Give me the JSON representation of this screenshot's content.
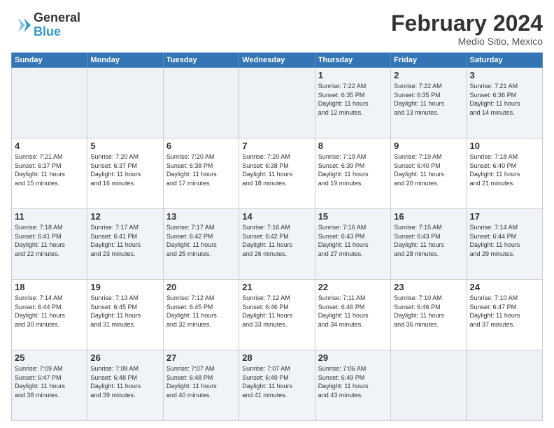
{
  "logo": {
    "general": "General",
    "blue": "Blue"
  },
  "title": "February 2024",
  "subtitle": "Medio Sitio, Mexico",
  "days_header": [
    "Sunday",
    "Monday",
    "Tuesday",
    "Wednesday",
    "Thursday",
    "Friday",
    "Saturday"
  ],
  "weeks": [
    [
      {
        "num": "",
        "info": ""
      },
      {
        "num": "",
        "info": ""
      },
      {
        "num": "",
        "info": ""
      },
      {
        "num": "",
        "info": ""
      },
      {
        "num": "1",
        "info": "Sunrise: 7:22 AM\nSunset: 6:35 PM\nDaylight: 11 hours\nand 12 minutes."
      },
      {
        "num": "2",
        "info": "Sunrise: 7:22 AM\nSunset: 6:35 PM\nDaylight: 11 hours\nand 13 minutes."
      },
      {
        "num": "3",
        "info": "Sunrise: 7:21 AM\nSunset: 6:36 PM\nDaylight: 11 hours\nand 14 minutes."
      }
    ],
    [
      {
        "num": "4",
        "info": "Sunrise: 7:21 AM\nSunset: 6:37 PM\nDaylight: 11 hours\nand 15 minutes."
      },
      {
        "num": "5",
        "info": "Sunrise: 7:20 AM\nSunset: 6:37 PM\nDaylight: 11 hours\nand 16 minutes."
      },
      {
        "num": "6",
        "info": "Sunrise: 7:20 AM\nSunset: 6:38 PM\nDaylight: 11 hours\nand 17 minutes."
      },
      {
        "num": "7",
        "info": "Sunrise: 7:20 AM\nSunset: 6:38 PM\nDaylight: 11 hours\nand 18 minutes."
      },
      {
        "num": "8",
        "info": "Sunrise: 7:19 AM\nSunset: 6:39 PM\nDaylight: 11 hours\nand 19 minutes."
      },
      {
        "num": "9",
        "info": "Sunrise: 7:19 AM\nSunset: 6:40 PM\nDaylight: 11 hours\nand 20 minutes."
      },
      {
        "num": "10",
        "info": "Sunrise: 7:18 AM\nSunset: 6:40 PM\nDaylight: 11 hours\nand 21 minutes."
      }
    ],
    [
      {
        "num": "11",
        "info": "Sunrise: 7:18 AM\nSunset: 6:41 PM\nDaylight: 11 hours\nand 22 minutes."
      },
      {
        "num": "12",
        "info": "Sunrise: 7:17 AM\nSunset: 6:41 PM\nDaylight: 11 hours\nand 23 minutes."
      },
      {
        "num": "13",
        "info": "Sunrise: 7:17 AM\nSunset: 6:42 PM\nDaylight: 11 hours\nand 25 minutes."
      },
      {
        "num": "14",
        "info": "Sunrise: 7:16 AM\nSunset: 6:42 PM\nDaylight: 11 hours\nand 26 minutes."
      },
      {
        "num": "15",
        "info": "Sunrise: 7:16 AM\nSunset: 6:43 PM\nDaylight: 11 hours\nand 27 minutes."
      },
      {
        "num": "16",
        "info": "Sunrise: 7:15 AM\nSunset: 6:43 PM\nDaylight: 11 hours\nand 28 minutes."
      },
      {
        "num": "17",
        "info": "Sunrise: 7:14 AM\nSunset: 6:44 PM\nDaylight: 11 hours\nand 29 minutes."
      }
    ],
    [
      {
        "num": "18",
        "info": "Sunrise: 7:14 AM\nSunset: 6:44 PM\nDaylight: 11 hours\nand 30 minutes."
      },
      {
        "num": "19",
        "info": "Sunrise: 7:13 AM\nSunset: 6:45 PM\nDaylight: 11 hours\nand 31 minutes."
      },
      {
        "num": "20",
        "info": "Sunrise: 7:12 AM\nSunset: 6:45 PM\nDaylight: 11 hours\nand 32 minutes."
      },
      {
        "num": "21",
        "info": "Sunrise: 7:12 AM\nSunset: 6:46 PM\nDaylight: 11 hours\nand 33 minutes."
      },
      {
        "num": "22",
        "info": "Sunrise: 7:11 AM\nSunset: 6:46 PM\nDaylight: 11 hours\nand 34 minutes."
      },
      {
        "num": "23",
        "info": "Sunrise: 7:10 AM\nSunset: 6:46 PM\nDaylight: 11 hours\nand 36 minutes."
      },
      {
        "num": "24",
        "info": "Sunrise: 7:10 AM\nSunset: 6:47 PM\nDaylight: 11 hours\nand 37 minutes."
      }
    ],
    [
      {
        "num": "25",
        "info": "Sunrise: 7:09 AM\nSunset: 6:47 PM\nDaylight: 11 hours\nand 38 minutes."
      },
      {
        "num": "26",
        "info": "Sunrise: 7:08 AM\nSunset: 6:48 PM\nDaylight: 11 hours\nand 39 minutes."
      },
      {
        "num": "27",
        "info": "Sunrise: 7:07 AM\nSunset: 6:48 PM\nDaylight: 11 hours\nand 40 minutes."
      },
      {
        "num": "28",
        "info": "Sunrise: 7:07 AM\nSunset: 6:49 PM\nDaylight: 11 hours\nand 41 minutes."
      },
      {
        "num": "29",
        "info": "Sunrise: 7:06 AM\nSunset: 6:49 PM\nDaylight: 11 hours\nand 43 minutes."
      },
      {
        "num": "",
        "info": ""
      },
      {
        "num": "",
        "info": ""
      }
    ]
  ]
}
